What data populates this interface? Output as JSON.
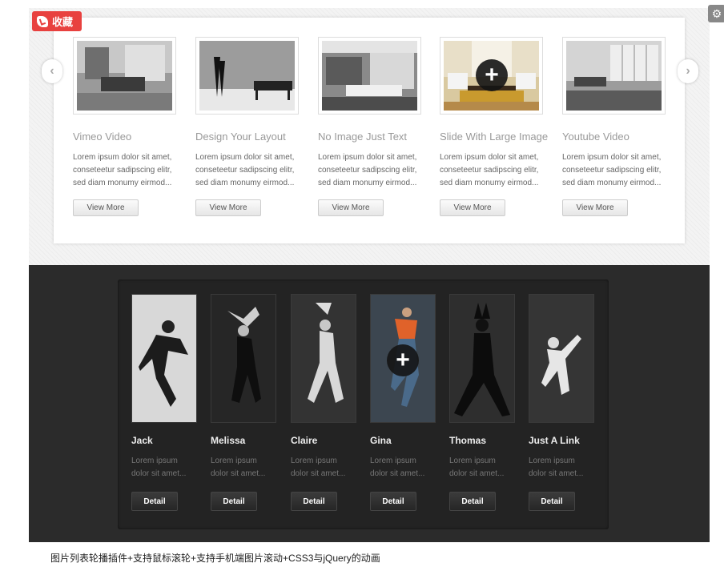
{
  "badge": {
    "label": "收藏",
    "icon": "heart-icon"
  },
  "corner_icon": "settings-icon",
  "top_carousel": {
    "prev_icon": "chevron-left-icon",
    "next_icon": "chevron-right-icon",
    "items": [
      {
        "title": "Vimeo Video",
        "desc": "Lorem ipsum dolor sit amet, conseteetur sadipscing elitr, sed diam monumy eirmod...",
        "button": "View More"
      },
      {
        "title": "Design Your Layout",
        "desc": "Lorem ipsum dolor sit amet, conseteetur sadipscing elitr, sed diam monumy eirmod...",
        "button": "View More"
      },
      {
        "title": "No Image Just Text",
        "desc": "Lorem ipsum dolor sit amet, conseteetur sadipscing elitr, sed diam monumy eirmod...",
        "button": "View More"
      },
      {
        "title": "Slide With Large Image",
        "desc": "Lorem ipsum dolor sit amet, conseteetur sadipscing elitr, sed diam monumy eirmod...",
        "button": "View More"
      },
      {
        "title": "Youtube Video",
        "desc": "Lorem ipsum dolor sit amet, conseteetur sadipscing elitr, sed diam monumy eirmod...",
        "button": "View More"
      }
    ]
  },
  "dark_carousel": {
    "items": [
      {
        "name": "Jack",
        "desc": "Lorem ipsum dolor sit amet...",
        "button": "Detail"
      },
      {
        "name": "Melissa",
        "desc": "Lorem ipsum dolor sit amet...",
        "button": "Detail"
      },
      {
        "name": "Claire",
        "desc": "Lorem ipsum dolor sit amet...",
        "button": "Detail"
      },
      {
        "name": "Gina",
        "desc": "Lorem ipsum dolor sit amet...",
        "button": "Detail"
      },
      {
        "name": "Thomas",
        "desc": "Lorem ipsum dolor sit amet...",
        "button": "Detail"
      },
      {
        "name": "Just A Link",
        "desc": "Lorem ipsum dolor sit amet...",
        "button": "Detail"
      }
    ]
  },
  "plus_icon": "+",
  "caption": "图片列表轮播插件+支持鼠标滚轮+支持手机端图片滚动+CSS3与jQuery的动画"
}
